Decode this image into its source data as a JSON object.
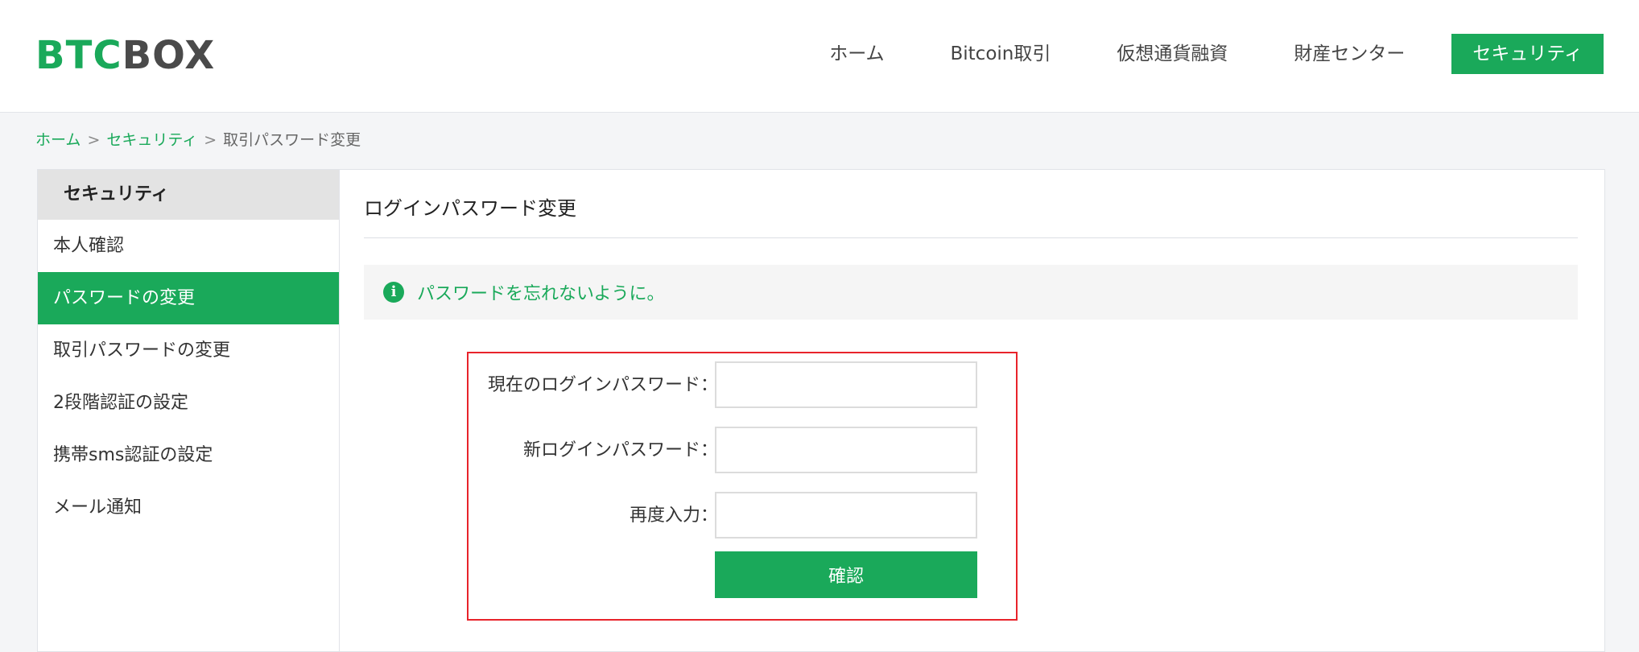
{
  "logo": {
    "part1": "BTC",
    "part2": "BOX"
  },
  "nav": {
    "items": [
      {
        "label": "ホーム"
      },
      {
        "label": "Bitcoin取引"
      },
      {
        "label": "仮想通貨融資"
      },
      {
        "label": "財産センター"
      },
      {
        "label": "セキュリティ"
      }
    ]
  },
  "breadcrumb": {
    "items": [
      "ホーム",
      "セキュリティ",
      "取引パスワード変更"
    ],
    "separator": ">"
  },
  "sidebar": {
    "title": "セキュリティ",
    "items": [
      {
        "label": "本人確認"
      },
      {
        "label": "パスワードの変更"
      },
      {
        "label": "取引パスワードの変更"
      },
      {
        "label": "2段階認証の設定"
      },
      {
        "label": "携帯sms認証の設定"
      },
      {
        "label": "メール通知"
      }
    ]
  },
  "main": {
    "title": "ログインパスワード変更",
    "notice": "パスワードを忘れないように。",
    "notice_icon": "info-icon",
    "form": {
      "current_label": "現在のログインパスワード：",
      "current_value": "",
      "new_label": "新ログインパスワード：",
      "new_value": "",
      "confirm_label": "再度入力：",
      "confirm_value": "",
      "submit_label": "確認"
    }
  },
  "colors": {
    "accent": "#1aa95a",
    "highlight_border": "#e8232b"
  }
}
